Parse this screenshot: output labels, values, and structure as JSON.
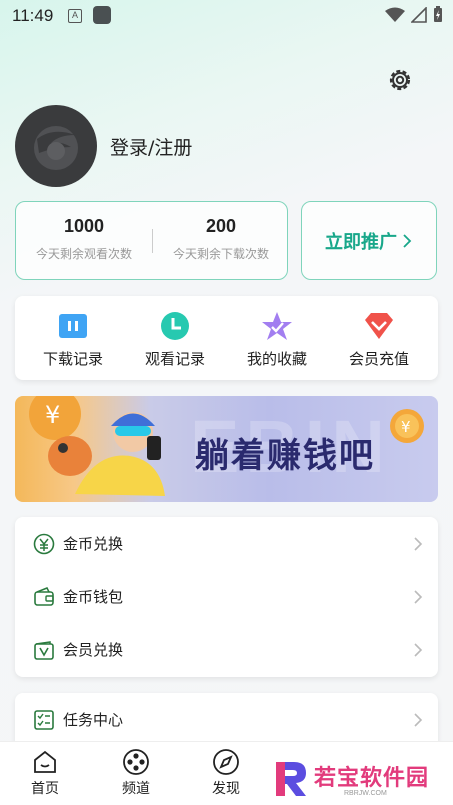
{
  "status_bar": {
    "time": "11:49",
    "indicator": "A"
  },
  "header": {
    "login_text": "登录/注册"
  },
  "stats": [
    {
      "value": "1000",
      "label": "今天剩余观看次数"
    },
    {
      "value": "200",
      "label": "今天剩余下载次数"
    }
  ],
  "promote": {
    "label": "立即推广"
  },
  "quick_actions": [
    {
      "label": "下载记录",
      "icon": "download-record-icon",
      "color": "#3fa4f4"
    },
    {
      "label": "观看记录",
      "icon": "clock-icon",
      "color": "#27c9b0"
    },
    {
      "label": "我的收藏",
      "icon": "star-icon",
      "color": "#a27ef0"
    },
    {
      "label": "会员充值",
      "icon": "vip-diamond-icon",
      "color": "#f0524a"
    }
  ],
  "banner": {
    "text": "躺着赚钱吧",
    "bg_text": "EBIN"
  },
  "menu": [
    {
      "label": "金币兑换",
      "icon": "coin-exchange-icon"
    },
    {
      "label": "金币钱包",
      "icon": "wallet-icon"
    },
    {
      "label": "会员兑换",
      "icon": "vip-exchange-icon"
    }
  ],
  "task": {
    "label": "任务中心",
    "icon": "task-list-icon"
  },
  "bottom_nav": [
    {
      "label": "首页",
      "icon": "home-icon"
    },
    {
      "label": "频道",
      "icon": "film-reel-icon"
    },
    {
      "label": "发现",
      "icon": "compass-icon"
    }
  ],
  "watermark": {
    "text": "若宝软件园",
    "sub": "RBRJW.COM"
  },
  "colors": {
    "accent": "#18a78a",
    "border": "#7fd4bb"
  }
}
